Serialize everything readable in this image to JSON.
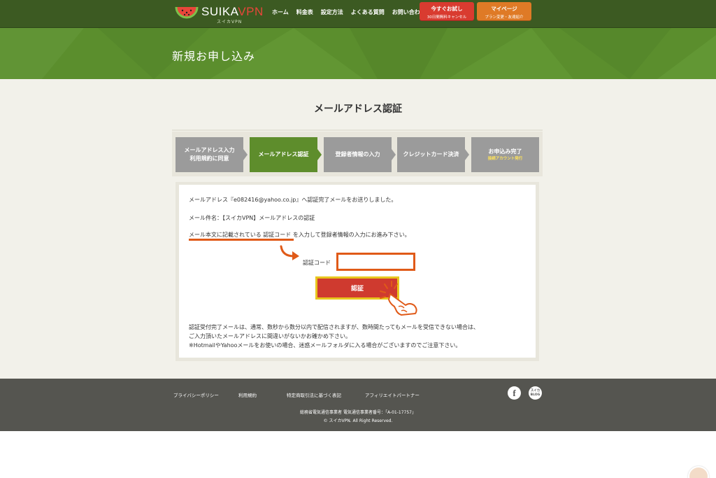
{
  "brand": {
    "name_main": "SUIKA",
    "name_accent": "VPN",
    "subtitle": "スイカVPN"
  },
  "nav": {
    "items": [
      "ホーム",
      "料金表",
      "設定方法",
      "よくある質問",
      "お問い合わせ"
    ]
  },
  "header_buttons": {
    "trial": {
      "label": "今すぐお試し",
      "sub": "30日間無料キャンセル"
    },
    "mypage": {
      "label": "マイページ",
      "sub": "プラン変更・友達紹介"
    }
  },
  "hero": {
    "title": "新規お申し込み"
  },
  "page": {
    "title": "メールアドレス認証"
  },
  "steps": [
    {
      "line1": "メールアドレス入力",
      "line2": "利用規約に同意",
      "note": "",
      "active": false
    },
    {
      "line1": "メールアドレス認証",
      "line2": "",
      "note": "",
      "active": true
    },
    {
      "line1": "登録者情報の入力",
      "line2": "",
      "note": "",
      "active": false
    },
    {
      "line1": "クレジットカード決済",
      "line2": "",
      "note": "",
      "active": false
    },
    {
      "line1": "お申込み完了",
      "line2": "",
      "note": "接続アカウント発行",
      "active": false
    }
  ],
  "panel": {
    "sent_message": "メールアドレス『e082416@yahoo.co.jp』へ認証完了メールをお送りしました。",
    "subject_line": "メール件名：【スイカVPN】メールアドレスの認証",
    "instruction": "メール本文に記載されている 認証コード を入力して登録者情報の入力にお進み下さい。",
    "code_label": "認証コード",
    "code_value": "",
    "submit_label": "認証",
    "notes": [
      "認証受付完了メールは、通常、数秒から数分以内で配信されますが、数時間たってもメールを受信できない場合は、",
      "ご入力頂いたメールアドレスに間違いがないかお確かめ下さい。",
      "※HotmailやYahooメールをお使いの場合、迷惑メールフォルダに入る場合がございますのでご注意下さい。"
    ]
  },
  "footer": {
    "links": [
      "プライバシーポリシー",
      "利用規約",
      "特定商取引法に基づく表記",
      "アフィリエイトパートナー"
    ],
    "facebook_glyph": "f",
    "blog_line1": "スイカ",
    "blog_line2": "BLOG",
    "license": "総務省電気通信事業者 電気通信事業者番号：「A-01-17757」",
    "copyright": "© スイカVPN. All Right Reserved."
  },
  "colors": {
    "header": "#3c5a22",
    "hero": "#5b8e2d",
    "active_step": "#5e8d2c",
    "inactive_step": "#9b9b9b",
    "submit": "#cf3a2f",
    "highlight": "#e05a18",
    "trial_button": "#d93b30",
    "mypage_button": "#df7a26",
    "footer": "#555550"
  },
  "icons": [
    "watermelon-logo-icon",
    "curved-arrow-icon",
    "pointing-hand-icon",
    "facebook-icon",
    "blog-icon"
  ]
}
